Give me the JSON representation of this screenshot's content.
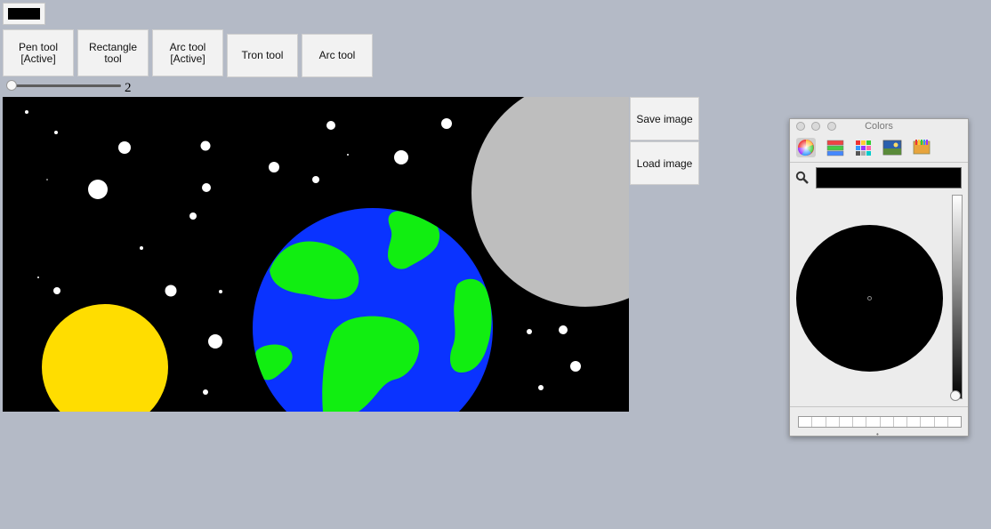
{
  "color_well": {
    "current_color": "#000000"
  },
  "toolbar": {
    "tools": [
      {
        "line1": "Pen tool",
        "line2": "[Active]"
      },
      {
        "line1": "Rectangle",
        "line2": "tool"
      },
      {
        "line1": "Arc tool",
        "line2": "[Active]"
      },
      {
        "line1": "Tron tool",
        "line2": ""
      },
      {
        "line1": "Arc tool",
        "line2": ""
      }
    ]
  },
  "stroke_width": {
    "value": "2"
  },
  "side_buttons": {
    "save_label": "Save image",
    "load_label": "Load image"
  },
  "canvas": {
    "background": "#000000",
    "sun_color": "#ffdd00",
    "moon_color": "#bebebe",
    "ocean_color": "#0a33ff",
    "land_color": "#11ee11",
    "star_color": "#ffffff"
  },
  "colors_panel": {
    "title": "Colors",
    "modes": [
      "color-wheel-icon",
      "sliders-icon",
      "palette-icon",
      "image-palette-icon",
      "crayons-icon"
    ],
    "selected_mode": "color-wheel-icon",
    "search_value": "",
    "selected_color": "#000000",
    "brightness": 0.0
  }
}
